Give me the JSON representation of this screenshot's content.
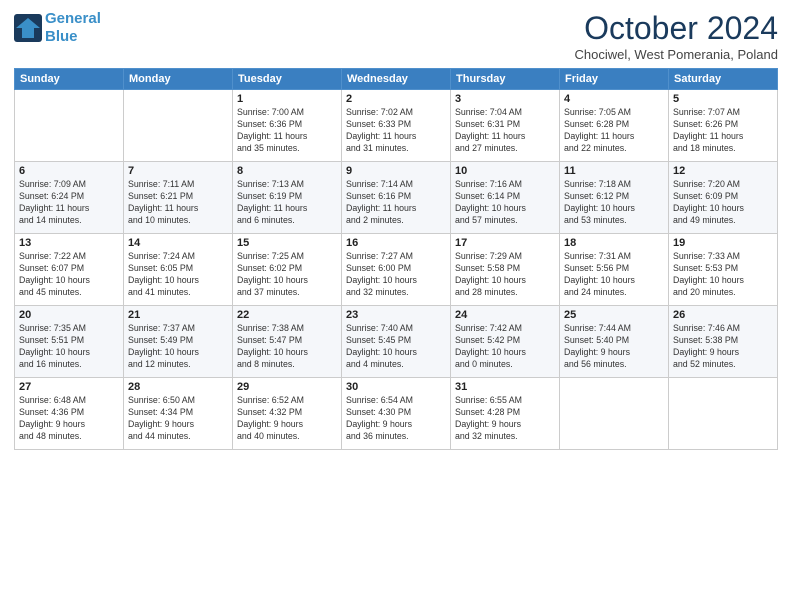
{
  "logo": {
    "line1": "General",
    "line2": "Blue"
  },
  "title": "October 2024",
  "location": "Chociwel, West Pomerania, Poland",
  "headers": [
    "Sunday",
    "Monday",
    "Tuesday",
    "Wednesday",
    "Thursday",
    "Friday",
    "Saturday"
  ],
  "weeks": [
    [
      {
        "day": "",
        "info": ""
      },
      {
        "day": "",
        "info": ""
      },
      {
        "day": "1",
        "info": "Sunrise: 7:00 AM\nSunset: 6:36 PM\nDaylight: 11 hours\nand 35 minutes."
      },
      {
        "day": "2",
        "info": "Sunrise: 7:02 AM\nSunset: 6:33 PM\nDaylight: 11 hours\nand 31 minutes."
      },
      {
        "day": "3",
        "info": "Sunrise: 7:04 AM\nSunset: 6:31 PM\nDaylight: 11 hours\nand 27 minutes."
      },
      {
        "day": "4",
        "info": "Sunrise: 7:05 AM\nSunset: 6:28 PM\nDaylight: 11 hours\nand 22 minutes."
      },
      {
        "day": "5",
        "info": "Sunrise: 7:07 AM\nSunset: 6:26 PM\nDaylight: 11 hours\nand 18 minutes."
      }
    ],
    [
      {
        "day": "6",
        "info": "Sunrise: 7:09 AM\nSunset: 6:24 PM\nDaylight: 11 hours\nand 14 minutes."
      },
      {
        "day": "7",
        "info": "Sunrise: 7:11 AM\nSunset: 6:21 PM\nDaylight: 11 hours\nand 10 minutes."
      },
      {
        "day": "8",
        "info": "Sunrise: 7:13 AM\nSunset: 6:19 PM\nDaylight: 11 hours\nand 6 minutes."
      },
      {
        "day": "9",
        "info": "Sunrise: 7:14 AM\nSunset: 6:16 PM\nDaylight: 11 hours\nand 2 minutes."
      },
      {
        "day": "10",
        "info": "Sunrise: 7:16 AM\nSunset: 6:14 PM\nDaylight: 10 hours\nand 57 minutes."
      },
      {
        "day": "11",
        "info": "Sunrise: 7:18 AM\nSunset: 6:12 PM\nDaylight: 10 hours\nand 53 minutes."
      },
      {
        "day": "12",
        "info": "Sunrise: 7:20 AM\nSunset: 6:09 PM\nDaylight: 10 hours\nand 49 minutes."
      }
    ],
    [
      {
        "day": "13",
        "info": "Sunrise: 7:22 AM\nSunset: 6:07 PM\nDaylight: 10 hours\nand 45 minutes."
      },
      {
        "day": "14",
        "info": "Sunrise: 7:24 AM\nSunset: 6:05 PM\nDaylight: 10 hours\nand 41 minutes."
      },
      {
        "day": "15",
        "info": "Sunrise: 7:25 AM\nSunset: 6:02 PM\nDaylight: 10 hours\nand 37 minutes."
      },
      {
        "day": "16",
        "info": "Sunrise: 7:27 AM\nSunset: 6:00 PM\nDaylight: 10 hours\nand 32 minutes."
      },
      {
        "day": "17",
        "info": "Sunrise: 7:29 AM\nSunset: 5:58 PM\nDaylight: 10 hours\nand 28 minutes."
      },
      {
        "day": "18",
        "info": "Sunrise: 7:31 AM\nSunset: 5:56 PM\nDaylight: 10 hours\nand 24 minutes."
      },
      {
        "day": "19",
        "info": "Sunrise: 7:33 AM\nSunset: 5:53 PM\nDaylight: 10 hours\nand 20 minutes."
      }
    ],
    [
      {
        "day": "20",
        "info": "Sunrise: 7:35 AM\nSunset: 5:51 PM\nDaylight: 10 hours\nand 16 minutes."
      },
      {
        "day": "21",
        "info": "Sunrise: 7:37 AM\nSunset: 5:49 PM\nDaylight: 10 hours\nand 12 minutes."
      },
      {
        "day": "22",
        "info": "Sunrise: 7:38 AM\nSunset: 5:47 PM\nDaylight: 10 hours\nand 8 minutes."
      },
      {
        "day": "23",
        "info": "Sunrise: 7:40 AM\nSunset: 5:45 PM\nDaylight: 10 hours\nand 4 minutes."
      },
      {
        "day": "24",
        "info": "Sunrise: 7:42 AM\nSunset: 5:42 PM\nDaylight: 10 hours\nand 0 minutes."
      },
      {
        "day": "25",
        "info": "Sunrise: 7:44 AM\nSunset: 5:40 PM\nDaylight: 9 hours\nand 56 minutes."
      },
      {
        "day": "26",
        "info": "Sunrise: 7:46 AM\nSunset: 5:38 PM\nDaylight: 9 hours\nand 52 minutes."
      }
    ],
    [
      {
        "day": "27",
        "info": "Sunrise: 6:48 AM\nSunset: 4:36 PM\nDaylight: 9 hours\nand 48 minutes."
      },
      {
        "day": "28",
        "info": "Sunrise: 6:50 AM\nSunset: 4:34 PM\nDaylight: 9 hours\nand 44 minutes."
      },
      {
        "day": "29",
        "info": "Sunrise: 6:52 AM\nSunset: 4:32 PM\nDaylight: 9 hours\nand 40 minutes."
      },
      {
        "day": "30",
        "info": "Sunrise: 6:54 AM\nSunset: 4:30 PM\nDaylight: 9 hours\nand 36 minutes."
      },
      {
        "day": "31",
        "info": "Sunrise: 6:55 AM\nSunset: 4:28 PM\nDaylight: 9 hours\nand 32 minutes."
      },
      {
        "day": "",
        "info": ""
      },
      {
        "day": "",
        "info": ""
      }
    ]
  ]
}
